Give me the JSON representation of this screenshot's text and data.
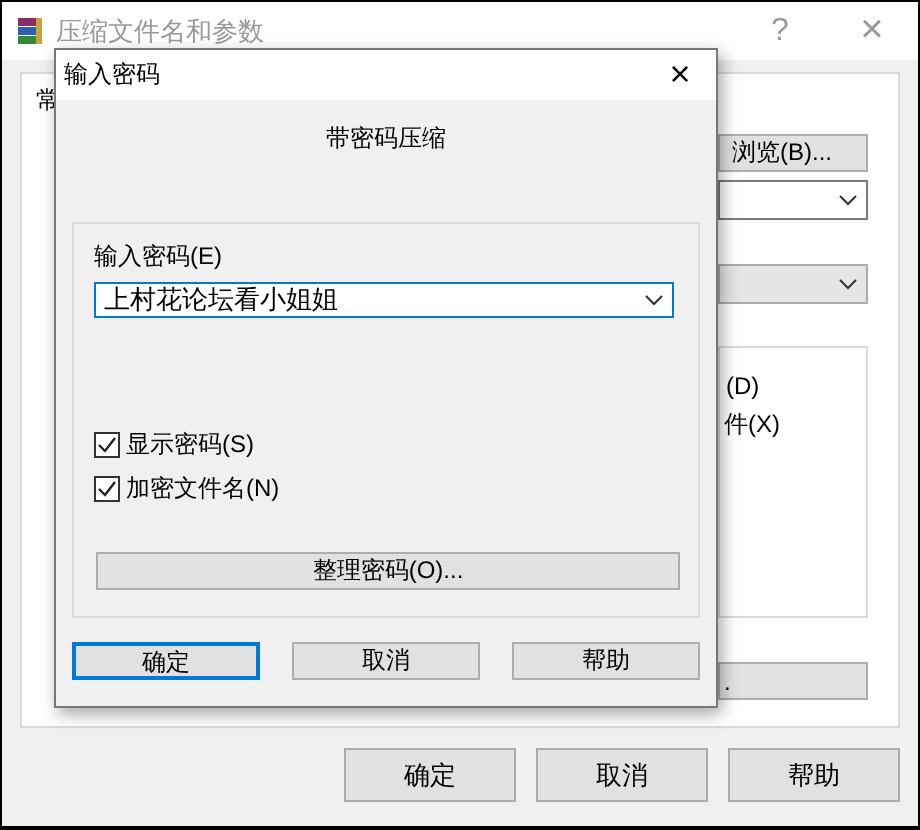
{
  "window": {
    "title": "压缩文件名和参数",
    "help": "?",
    "close": "×"
  },
  "tab": {
    "label": "常"
  },
  "background_controls": {
    "browse": "浏览(B)...",
    "option_1": "(D)",
    "option_2": "件(X)",
    "button": "."
  },
  "buttons": [
    {
      "label": "确定"
    },
    {
      "label": "取消"
    },
    {
      "label": "帮助"
    }
  ],
  "dialog": {
    "title": "输入密码",
    "close": "×",
    "heading": "带密码压缩",
    "password_label": "输入密码(E)",
    "password_value": "上村花论坛看小姐姐",
    "checkboxes": [
      {
        "label": "显示密码(S)",
        "checked": true
      },
      {
        "label": "加密文件名(N)",
        "checked": true
      }
    ],
    "organize_button": "整理密码(O)...",
    "buttons": [
      {
        "label": "确定",
        "default": true
      },
      {
        "label": "取消",
        "default": false
      },
      {
        "label": "帮助",
        "default": false
      }
    ]
  }
}
